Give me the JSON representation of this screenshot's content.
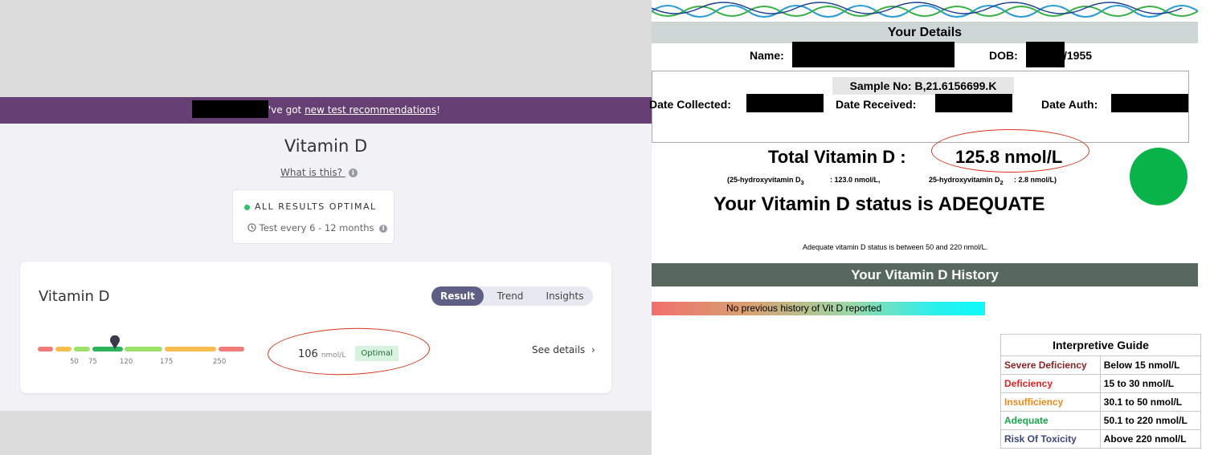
{
  "left": {
    "banner": {
      "text": "'ve got ",
      "link": "new test recommendations",
      "suffix": "!"
    },
    "title": "Vitamin D",
    "what_link": "What is this?",
    "status": {
      "label": "ALL RESULTS OPTIMAL",
      "frequency": "Test every 6 - 12 months"
    },
    "card": {
      "title": "Vitamin D",
      "tabs": [
        "Result",
        "Trend",
        "Insights"
      ],
      "active_tab": "Result",
      "gauge_ticks": [
        "50",
        "75",
        "120",
        "175",
        "250"
      ],
      "value": "106",
      "unit": "nmol/L",
      "badge": "Optimal",
      "see_details": "See details",
      "colors": {
        "red": "#f07b7b",
        "yellow": "#f7be4f",
        "lightgreen": "#9fe06a",
        "green": "#2fb35a",
        "accent": "#663f74"
      }
    }
  },
  "right": {
    "details_header": "Your Details",
    "name_label": "Name:",
    "dob_label": "DOB:",
    "dob_year": "/1955",
    "sample_no": "Sample No:  B,21.6156699.K",
    "date_collected": "Date Collected:",
    "date_received": "Date Received:",
    "date_auth": "Date Auth:",
    "total_label": "Total Vitamin D  :",
    "total_value": "125.8 nmol/L",
    "sub_d3_a": "(25-hydroxyvitamin D",
    "sub_d3_b": "3",
    "sub_d3_val": ":   123.0 nmol/L,",
    "sub_d2_a": "25-hydroxyvitamin D",
    "sub_d2_b": "2",
    "sub_d2_val": ":   2.8 nmol/L)",
    "status_text": "Your Vitamin D status is ADEQUATE",
    "adequate_note": "Adequate vitamin D status is between 50 and 220 nmol/L.",
    "history_header": "Your Vitamin D History",
    "history_text": "No previous history of Vit D reported",
    "guide": {
      "title": "Interpretive Guide",
      "rows": [
        {
          "label": "Severe Deficiency",
          "range": "Below 15 nmol/L",
          "color": "#8b2525"
        },
        {
          "label": "Deficiency",
          "range": "15 to 30 nmol/L",
          "color": "#e82020"
        },
        {
          "label": "Insufficiency",
          "range": "30.1 to 50 nmol/L",
          "color": "#e98a1d"
        },
        {
          "label": "Adequate",
          "range": "50.1 to 220 nmol/L",
          "color": "#19a84a"
        },
        {
          "label": "Risk Of Toxicity",
          "range": "Above 220 nmol/L",
          "color": "#3a4a7a"
        }
      ]
    }
  }
}
